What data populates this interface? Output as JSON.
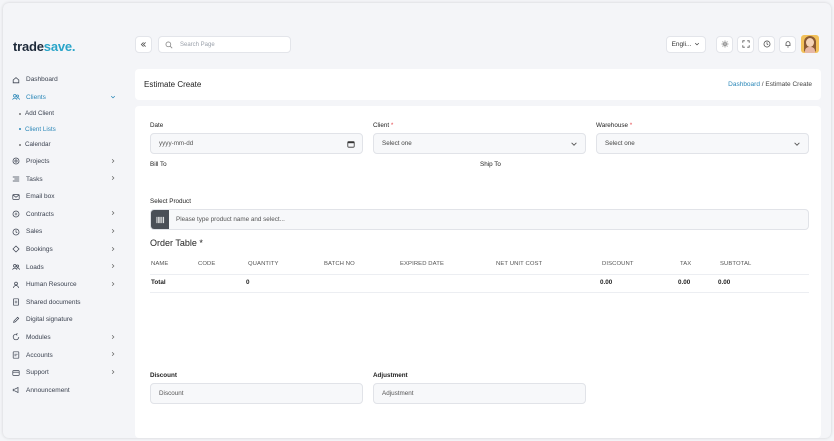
{
  "brand": {
    "part1": "trade",
    "part2": "save."
  },
  "search": {
    "placeholder": "Search Page"
  },
  "topbar": {
    "language": "Engli..."
  },
  "sidebar": {
    "items": [
      {
        "label": "Dashboard",
        "icon": "home-icon"
      },
      {
        "label": "Clients",
        "icon": "users-icon"
      },
      {
        "label": "Projects",
        "icon": "target-icon"
      },
      {
        "label": "Tasks",
        "icon": "list-icon"
      },
      {
        "label": "Email box",
        "icon": "mail-icon"
      },
      {
        "label": "Contracts",
        "icon": "contract-icon"
      },
      {
        "label": "Sales",
        "icon": "sales-icon"
      },
      {
        "label": "Bookings",
        "icon": "bookings-icon"
      },
      {
        "label": "Loads",
        "icon": "users-icon"
      },
      {
        "label": "Human Resource",
        "icon": "user-icon"
      },
      {
        "label": "Shared documents",
        "icon": "document-icon"
      },
      {
        "label": "Digital signature",
        "icon": "pen-icon"
      },
      {
        "label": "Modules",
        "icon": "modules-icon"
      },
      {
        "label": "Accounts",
        "icon": "accounts-icon"
      },
      {
        "label": "Support",
        "icon": "support-icon"
      },
      {
        "label": "Announcement",
        "icon": "megaphone-icon"
      }
    ],
    "client_subitems": [
      "Add Client",
      "Client Lists",
      "Calendar"
    ]
  },
  "page": {
    "title": "Estimate Create",
    "breadcrumb_link": "Dashboard",
    "breadcrumb_sep": "/",
    "breadcrumb_current": "Estimate Create"
  },
  "form": {
    "date_label": "Date",
    "date_placeholder": "yyyy-mm-dd",
    "client_label": "Client",
    "client_value": "Select one",
    "warehouse_label": "Warehouse",
    "warehouse_value": "Select one",
    "required_mark": "*",
    "bill_to_label": "Bill To",
    "ship_to_label": "Ship To",
    "select_product_label": "Select Product",
    "product_placeholder": "Please type product name and select...",
    "order_table_title": "Order Table *",
    "discount_label": "Discount",
    "discount_placeholder": "Discount",
    "adjustment_label": "Adjustment",
    "adjustment_placeholder": "Adjustment"
  },
  "table": {
    "headers": [
      "NAME",
      "CODE",
      "QUANTITY",
      "BATCH NO",
      "EXPIRED DATE",
      "NET UNIT COST",
      "DISCOUNT",
      "TAX",
      "SUBTOTAL"
    ],
    "total_row": {
      "name": "Total",
      "quantity": "0",
      "discount": "0.00",
      "tax": "0.00",
      "subtotal": "0.00"
    }
  },
  "colors": {
    "accent": "#2a87b8",
    "brand_dark": "#1e2a3a",
    "brand_light": "#2aa5c9",
    "required": "#e5484d"
  }
}
